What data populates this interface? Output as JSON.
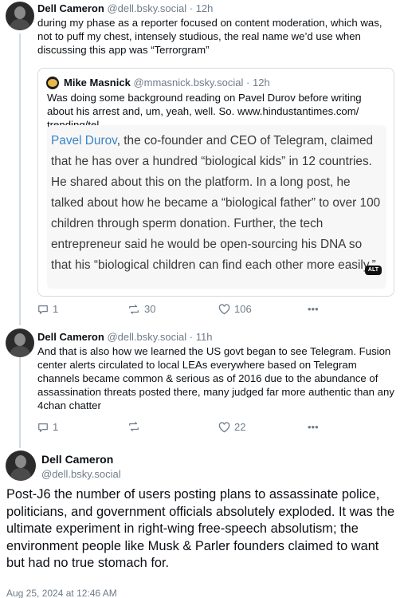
{
  "posts": [
    {
      "author_name": "Dell Cameron",
      "author_handle": "@dell.bsky.social",
      "time": "12h",
      "text": "during my phase as a reporter focused on content moderation, which was, not to puff my chest, intensely studious, the real name we’d use when discussing this app was “Terrorgram”",
      "quote": {
        "author_name": "Mike Masnick",
        "author_handle": "@mmasnick.bsky.social",
        "time": "12h",
        "text": "Was doing some background reading on Pavel Durov before writing about his arrest and, um, yeah, well. So. www.hindustantimes.com/ trending/tel...",
        "image": {
          "link_text": "Pavel Durov",
          "text": ", the co-founder and CEO of Telegram, claimed that he has over a hundred “biological kids” in 12 countries. He shared about this on the platform. In a long post, he talked about how he became a “biological father” to over 100 children through sperm donation. Further, the tech entrepreneur said he would be open-sourcing his DNA so that his “biological children can find each other more easily.”",
          "alt_badge": "ALT"
        }
      },
      "replies": "1",
      "reposts": "30",
      "likes": "106",
      "more": "•••"
    },
    {
      "author_name": "Dell Cameron",
      "author_handle": "@dell.bsky.social",
      "time": "11h",
      "text": "And that is also how we learned the US govt began to see Telegram. Fusion center alerts circulated to local LEAs everywhere based on Telegram channels became common & serious as of 2016 due to the abundance of assassination threats posted there, many judged far more authentic than any 4chan chatter",
      "replies": "1",
      "reposts": "",
      "likes": "22",
      "more": "•••"
    }
  ],
  "main_post": {
    "author_name": "Dell Cameron",
    "author_handle": "@dell.bsky.social",
    "text": "Post-J6 the number of users posting plans to assassinate police, politicians, and government officials absolutely exploded. It was the ultimate experiment in right-wing free-speech absolutism; the environment people like Musk & Parler founders claimed to want but had no true stomach for.",
    "timestamp": "Aug 25, 2024 at 12:46 AM"
  },
  "colors": {
    "text": "#0b0f14",
    "muted": "#6f7c8a",
    "border": "#d4dbe2",
    "link": "#3b84c5"
  }
}
